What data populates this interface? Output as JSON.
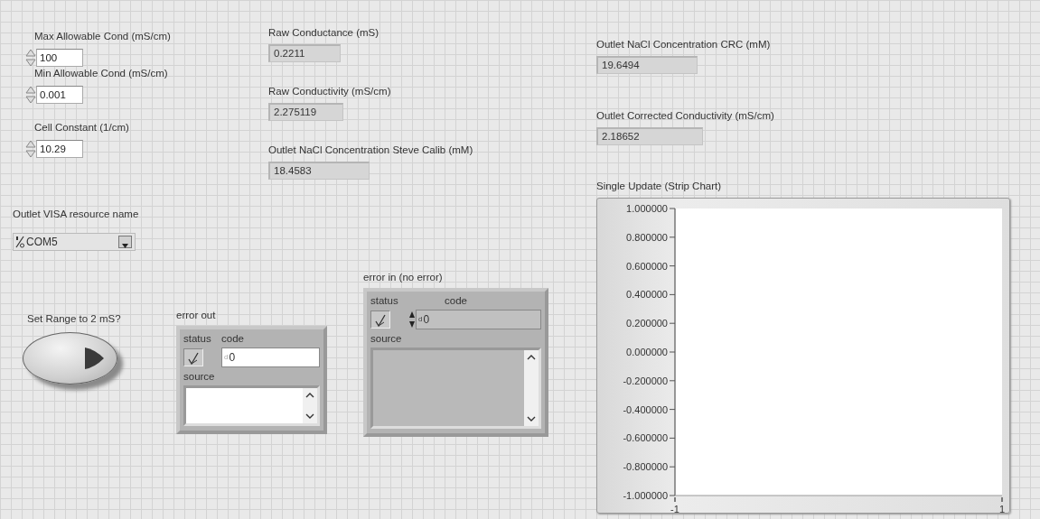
{
  "numeric_controls": [
    {
      "label": "Max Allowable Cond (mS/cm)",
      "value": "100"
    },
    {
      "label": "Min Allowable Cond (mS/cm)",
      "value": "0.001"
    },
    {
      "label": "Cell Constant (1/cm)",
      "value": "10.29"
    }
  ],
  "visa_resource": {
    "label": "Outlet VISA resource name",
    "value": "COM5"
  },
  "indicators": [
    {
      "label": "Raw Conductance (mS)",
      "value": "0.2211"
    },
    {
      "label": "Raw Conductivity (mS/cm)",
      "value": "2.275119"
    },
    {
      "label": "Outlet NaCl Concentration Steve Calib (mM)",
      "value": "18.4583"
    },
    {
      "label": "Outlet NaCl Concentration CRC (mM)",
      "value": "19.6494"
    },
    {
      "label": "Outlet Corrected Conductivity (mS/cm)",
      "value": "2.18652"
    }
  ],
  "boolean_button": {
    "label": "Set Range to 2 mS?",
    "on": false
  },
  "error_clusters": [
    {
      "label": "error out",
      "kind": "indicator",
      "disabled": false,
      "status_label": "status",
      "status_error": false,
      "code_label": "code",
      "radix": "d",
      "code": "0",
      "source_label": "source"
    },
    {
      "label": "error in (no error)",
      "kind": "control",
      "disabled": true,
      "status_label": "status",
      "status_error": false,
      "code_label": "code",
      "radix": "d",
      "code": "0",
      "source_label": "source"
    }
  ],
  "chart": {
    "chart_data": {
      "type": "line",
      "title": "Single Update (Strip Chart)",
      "xlim": [
        -1,
        1
      ],
      "ylim": [
        -1,
        1
      ],
      "xticks": [
        -1,
        1
      ],
      "yticks": [
        {
          "value": 1,
          "label": "1.000000"
        },
        {
          "value": 0.8,
          "label": "0.800000"
        },
        {
          "value": 0.6,
          "label": "0.600000"
        },
        {
          "value": 0.4,
          "label": "0.400000"
        },
        {
          "value": 0.2,
          "label": "0.200000"
        },
        {
          "value": 0,
          "label": "0.000000"
        },
        {
          "value": -0.2,
          "label": "-0.200000"
        },
        {
          "value": -0.4,
          "label": "-0.400000"
        },
        {
          "value": -0.6,
          "label": "-0.600000"
        },
        {
          "value": -0.8,
          "label": "-0.800000"
        },
        {
          "value": -1,
          "label": "-1.000000"
        }
      ]
    }
  }
}
